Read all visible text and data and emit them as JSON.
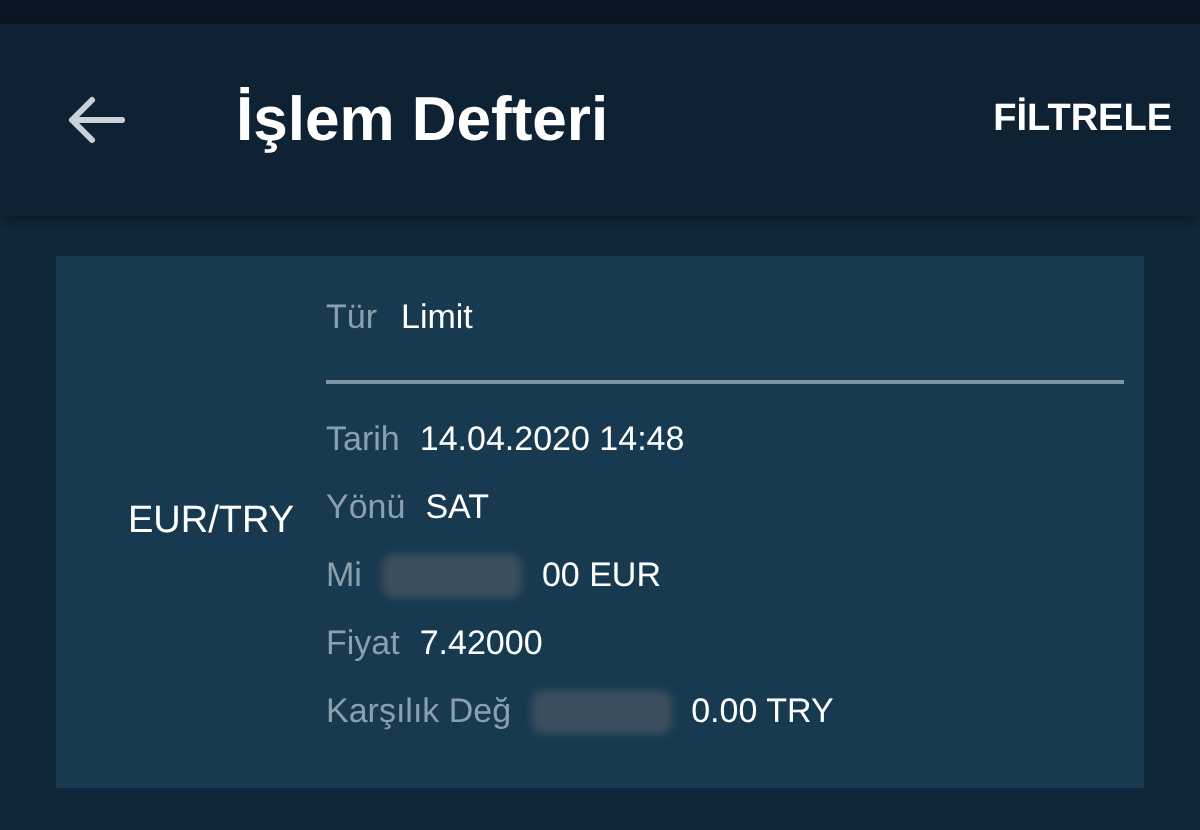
{
  "header": {
    "title": "İşlem Defteri",
    "action": "FİLTRELE"
  },
  "order": {
    "pair": "EUR/TRY",
    "type": {
      "label": "Tür",
      "value": "Limit"
    },
    "fields": [
      {
        "label": "Tarih",
        "value": "14.04.2020 14:48",
        "kind": "plain"
      },
      {
        "label": "Yönü",
        "value": "SAT",
        "kind": "plain"
      },
      {
        "label": "Mi",
        "value": "00 EUR",
        "kind": "masked"
      },
      {
        "label": "Fiyat",
        "value": "7.42000",
        "kind": "plain"
      },
      {
        "label": "Karşılık Değ",
        "value": "0.00 TRY",
        "kind": "masked"
      }
    ]
  }
}
